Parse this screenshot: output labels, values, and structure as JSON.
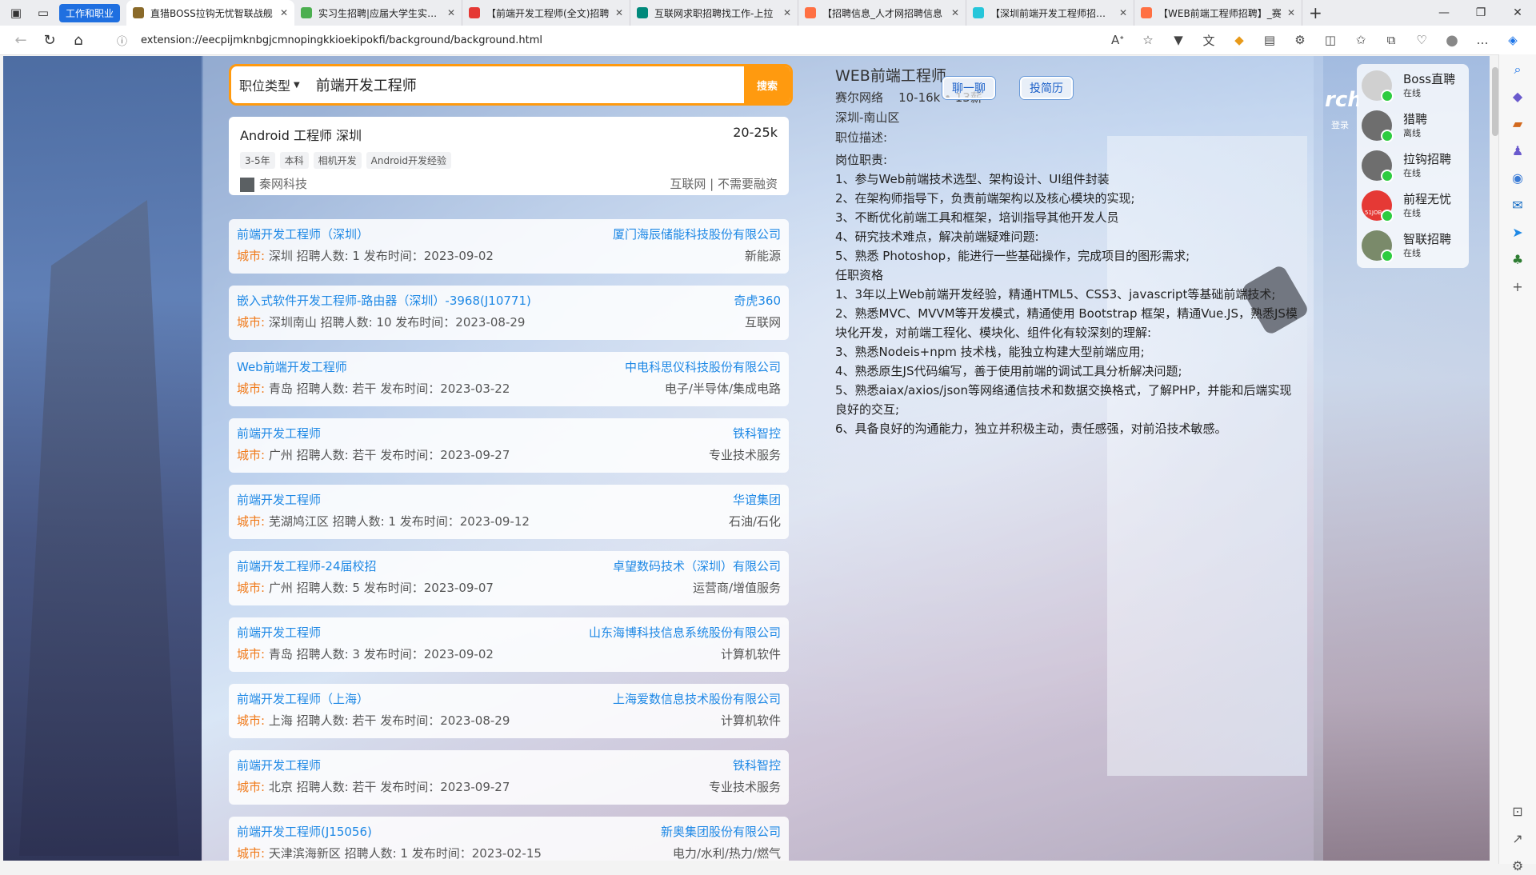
{
  "browser": {
    "tab_group_label": "工作和职业",
    "tabs": [
      {
        "title": "直猎BOSS拉钩无忧智联战舰",
        "active": true,
        "fav_color": "#8a6a2a"
      },
      {
        "title": "实习生招聘|应届大学生实习招",
        "active": false,
        "fav_color": "#4caf50"
      },
      {
        "title": "【前端开发工程师(全文)招聘",
        "active": false,
        "fav_color": "#e53935"
      },
      {
        "title": "互联网求职招聘找工作-上拉",
        "active": false,
        "fav_color": "#00897b"
      },
      {
        "title": "【招聘信息_人才网招聘信息",
        "active": false,
        "fav_color": "#ff7043"
      },
      {
        "title": "【深圳前端开发工程师招聘】",
        "active": false,
        "fav_color": "#26c6da"
      },
      {
        "title": "【WEB前端工程师招聘】_赛",
        "active": false,
        "fav_color": "#ff7043"
      }
    ],
    "url": "extension://eecpijmknbgjcmnopingkkioekipokfi/background/background.html"
  },
  "search": {
    "category_label": "职位类型",
    "query": "前端开发工程师",
    "button_label": "搜索"
  },
  "featured": {
    "title": "Android 工程师 深圳",
    "salary": "20-25k",
    "tags": [
      "3-5年",
      "本科",
      "相机开发",
      "Android开发经验"
    ],
    "company": "秦网科技",
    "industry": "互联网 | 不需要融资"
  },
  "jobs": [
    {
      "title": "前端开发工程师（深圳）",
      "company": "厦门海辰储能科技股份有限公司",
      "city_label": "城市:",
      "info": "深圳 招聘人数: 1 发布时间：2023-09-02",
      "industry": "新能源"
    },
    {
      "title": "嵌入式软件开发工程师-路由器（深圳）-3968(J10771)",
      "company": "奇虎360",
      "city_label": "城市:",
      "info": "深圳南山 招聘人数: 10 发布时间：2023-08-29",
      "industry": "互联网"
    },
    {
      "title": "Web前端开发工程师",
      "company": "中电科思仪科技股份有限公司",
      "city_label": "城市:",
      "info": "青岛 招聘人数: 若干 发布时间：2023-03-22",
      "industry": "电子/半导体/集成电路"
    },
    {
      "title": "前端开发工程师",
      "company": "铁科智控",
      "city_label": "城市:",
      "info": "广州 招聘人数: 若干 发布时间：2023-09-27",
      "industry": "专业技术服务"
    },
    {
      "title": "前端开发工程师",
      "company": "华谊集团",
      "city_label": "城市:",
      "info": "芜湖鸠江区 招聘人数: 1 发布时间：2023-09-12",
      "industry": "石油/石化"
    },
    {
      "title": "前端开发工程师-24届校招",
      "company": "卓望数码技术（深圳）有限公司",
      "city_label": "城市:",
      "info": "广州 招聘人数: 5 发布时间：2023-09-07",
      "industry": "运营商/增值服务"
    },
    {
      "title": "前端开发工程师",
      "company": "山东海博科技信息系统股份有限公司",
      "city_label": "城市:",
      "info": "青岛 招聘人数: 3 发布时间：2023-09-02",
      "industry": "计算机软件"
    },
    {
      "title": "前端开发工程师（上海）",
      "company": "上海爱数信息技术股份有限公司",
      "city_label": "城市:",
      "info": "上海 招聘人数: 若干 发布时间：2023-08-29",
      "industry": "计算机软件"
    },
    {
      "title": "前端开发工程师",
      "company": "铁科智控",
      "city_label": "城市:",
      "info": "北京 招聘人数: 若干 发布时间：2023-09-27",
      "industry": "专业技术服务"
    },
    {
      "title": "前端开发工程师(J15056)",
      "company": "新奥集团股份有限公司",
      "city_label": "城市:",
      "info": "天津滨海新区 招聘人数: 1 发布时间：2023-02-15",
      "industry": "电力/水利/热力/燃气"
    }
  ],
  "detail": {
    "title": "WEB前端工程师",
    "company_salary": "赛尔网络    10-16k • 13薪",
    "location": "深圳-南山区",
    "desc_label": "职位描述:",
    "lines": [
      "岗位职责:",
      "1、参与Web前端技术选型、架构设计、UI组件封装",
      "2、在架构师指导下，负责前端架构以及核心模块的实现;",
      "3、不断优化前端工具和框架，培训指导其他开发人员",
      "4、研究技术难点，解决前端疑难问题:",
      "5、熟悉 Photoshop，能进行一些基础操作，完成项目的图形需求;",
      "任职资格",
      "1、3年以上Web前端开发经验，精通HTML5、CSS3、javascript等基础前端技术;",
      "2、熟悉MVC、MVVM等开发模式，精通使用 Bootstrap 框架，精通Vue.JS，熟悉JS模块化开发，对前端工程化、模块化、组件化有较深刻的理解:",
      "3、熟悉Nodeis+npm 技术栈，能独立构建大型前端应用;",
      "4、熟悉原生JS代码编写，善于使用前端的调试工具分析解决问题;",
      "5、熟悉aiax/axios/json等网络通信技术和数据交换格式，了解PHP，并能和后端实现良好的交互;",
      "6、具备良好的沟通能力，独立并积极主动，责任感强，对前沿技术敏感。"
    ],
    "chat_label": "聊一聊",
    "resume_label": "投简历"
  },
  "login_label": "登录",
  "platforms": [
    {
      "name": "Boss直聘",
      "status": "在线",
      "avatar_color": "#d0d0d0"
    },
    {
      "name": "猎聘",
      "status": "离线",
      "avatar_color": "#6e6e6e"
    },
    {
      "name": "拉钩招聘",
      "status": "在线",
      "avatar_color": "#6e6e6e"
    },
    {
      "name": "前程无忧",
      "status": "在线",
      "avatar_color": "#e53935",
      "badge": "51JOB"
    },
    {
      "name": "智联招聘",
      "status": "在线",
      "avatar_color": "#7a8a6a"
    }
  ]
}
